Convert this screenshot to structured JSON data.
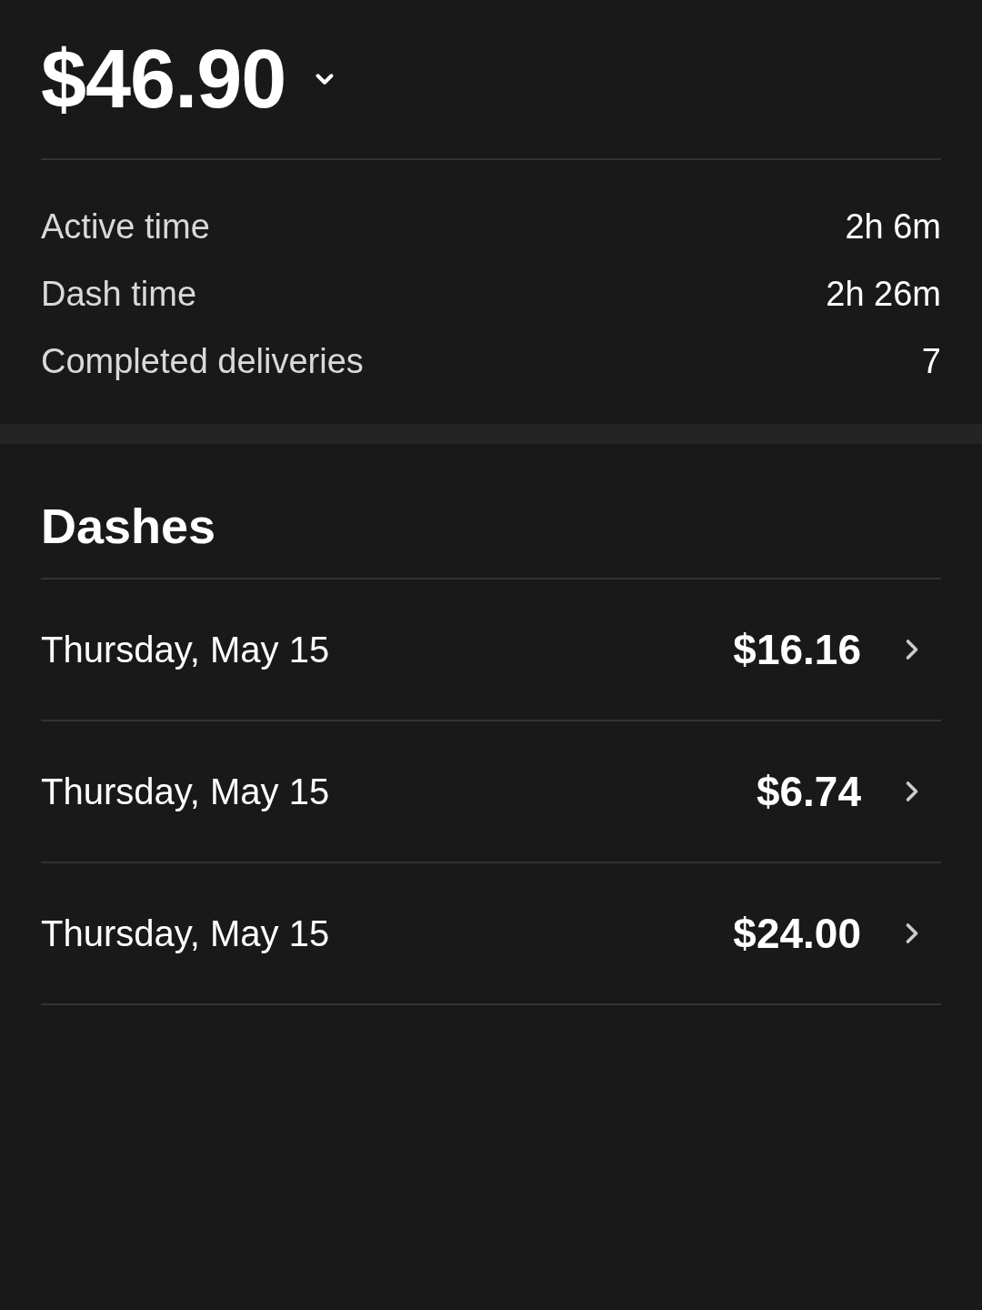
{
  "earnings": {
    "total": "$46.90",
    "expanded": false
  },
  "stats": [
    {
      "label": "Active time",
      "value": "2h 6m"
    },
    {
      "label": "Dash time",
      "value": "2h 26m"
    },
    {
      "label": "Completed deliveries",
      "value": "7"
    }
  ],
  "dashes": {
    "title": "Dashes",
    "items": [
      {
        "date": "Thursday, May 15",
        "amount": "$16.16"
      },
      {
        "date": "Thursday, May 15",
        "amount": "$6.74"
      },
      {
        "date": "Thursday, May 15",
        "amount": "$24.00"
      }
    ]
  }
}
